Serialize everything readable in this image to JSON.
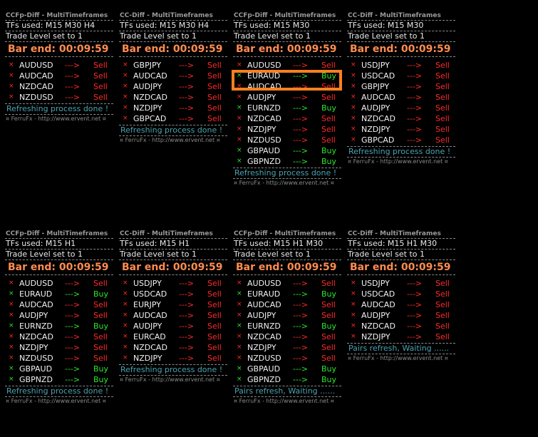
{
  "panels": [
    {
      "title": "CCFp-Diff   -   MultiTimeframes",
      "tfs": "TFs used: M15 M30 H4",
      "trade_level": "Trade Level set to 1",
      "bar_end": "Bar end: 00:09:59",
      "rows": [
        {
          "pair": "AUDUSD",
          "arrow": "--->",
          "signal": "Sell"
        },
        {
          "pair": "AUDCAD",
          "arrow": "--->",
          "signal": "Sell"
        },
        {
          "pair": "NZDCAD",
          "arrow": "--->",
          "signal": "Sell"
        },
        {
          "pair": "NZDUSD",
          "arrow": "--->",
          "signal": "Sell"
        }
      ],
      "status": "Refreshing process done !",
      "footer": "¤ FerruFx  - http://www.ervent.net ¤"
    },
    {
      "title": "CC-Diff   -   MultiTimeframes",
      "tfs": "TFs used: M15 M30 H4",
      "trade_level": "Trade Level set to 1",
      "bar_end": "Bar end: 00:09:59",
      "rows": [
        {
          "pair": "GBPJPY",
          "arrow": "--->",
          "signal": "Sell"
        },
        {
          "pair": "AUDCAD",
          "arrow": "--->",
          "signal": "Sell"
        },
        {
          "pair": "AUDJPY",
          "arrow": "--->",
          "signal": "Sell"
        },
        {
          "pair": "NZDCAD",
          "arrow": "--->",
          "signal": "Sell"
        },
        {
          "pair": "NZDJPY",
          "arrow": "--->",
          "signal": "Sell"
        },
        {
          "pair": "GBPCAD",
          "arrow": "--->",
          "signal": "Sell"
        }
      ],
      "status": "Refreshing process done !",
      "footer": "¤ FerruFx  - http://www.ervent.net ¤"
    },
    {
      "title": "CCFp-Diff   -   MultiTimeframes",
      "tfs": "TFs used: M15 M30",
      "trade_level": "Trade Level set to 1",
      "bar_end": "Bar end: 00:09:59",
      "rows": [
        {
          "pair": "AUDUSD",
          "arrow": "--->",
          "signal": "Sell"
        },
        {
          "pair": "EURAUD",
          "arrow": "--->",
          "signal": "Buy"
        },
        {
          "pair": "AUDCAD",
          "arrow": "--->",
          "signal": "Sell"
        },
        {
          "pair": "AUDJPY",
          "arrow": "--->",
          "signal": "Sell"
        },
        {
          "pair": "EURNZD",
          "arrow": "--->",
          "signal": "Buy"
        },
        {
          "pair": "NZDCAD",
          "arrow": "--->",
          "signal": "Sell"
        },
        {
          "pair": "NZDJPY",
          "arrow": "--->",
          "signal": "Sell"
        },
        {
          "pair": "NZDUSD",
          "arrow": "--->",
          "signal": "Sell"
        },
        {
          "pair": "GBPAUD",
          "arrow": "--->",
          "signal": "Buy"
        },
        {
          "pair": "GBPNZD",
          "arrow": "--->",
          "signal": "Buy"
        }
      ],
      "status": "Refreshing process done !",
      "footer": "¤ FerruFx  - http://www.ervent.net ¤"
    },
    {
      "title": "CC-Diff   -   MultiTimeframes",
      "tfs": "TFs used: M15 M30",
      "trade_level": "Trade Level set to 1",
      "bar_end": "Bar end: 00:09:59",
      "rows": [
        {
          "pair": "USDJPY",
          "arrow": "--->",
          "signal": "Sell"
        },
        {
          "pair": "USDCAD",
          "arrow": "--->",
          "signal": "Sell"
        },
        {
          "pair": "GBPJPY",
          "arrow": "--->",
          "signal": "Sell"
        },
        {
          "pair": "AUDCAD",
          "arrow": "--->",
          "signal": "Sell"
        },
        {
          "pair": "AUDJPY",
          "arrow": "--->",
          "signal": "Sell"
        },
        {
          "pair": "NZDCAD",
          "arrow": "--->",
          "signal": "Sell"
        },
        {
          "pair": "NZDJPY",
          "arrow": "--->",
          "signal": "Sell"
        },
        {
          "pair": "GBPCAD",
          "arrow": "--->",
          "signal": "Sell"
        }
      ],
      "status": "Refreshing process done !",
      "footer": "¤ FerruFx  - http://www.ervent.net ¤"
    },
    {
      "title": "CCFp-Diff   -   MultiTimeframes",
      "tfs": "TFs used: M15 H1",
      "trade_level": "Trade Level set to 1",
      "bar_end": "Bar end: 00:09:59",
      "rows": [
        {
          "pair": "AUDUSD",
          "arrow": "--->",
          "signal": "Sell"
        },
        {
          "pair": "EURAUD",
          "arrow": "--->",
          "signal": "Buy"
        },
        {
          "pair": "AUDCAD",
          "arrow": "--->",
          "signal": "Sell"
        },
        {
          "pair": "AUDJPY",
          "arrow": "--->",
          "signal": "Sell"
        },
        {
          "pair": "EURNZD",
          "arrow": "--->",
          "signal": "Buy"
        },
        {
          "pair": "NZDCAD",
          "arrow": "--->",
          "signal": "Sell"
        },
        {
          "pair": "NZDJPY",
          "arrow": "--->",
          "signal": "Sell"
        },
        {
          "pair": "NZDUSD",
          "arrow": "--->",
          "signal": "Sell"
        },
        {
          "pair": "GBPAUD",
          "arrow": "--->",
          "signal": "Buy"
        },
        {
          "pair": "GBPNZD",
          "arrow": "--->",
          "signal": "Buy"
        }
      ],
      "status": "Refreshing process done !",
      "footer": "¤ FerruFx  - http://www.ervent.net ¤"
    },
    {
      "title": "CC-Diff   -   MultiTimeframes",
      "tfs": "TFs used: M15 H1",
      "trade_level": "Trade Level set to 1",
      "bar_end": "Bar end: 00:09:59",
      "rows": [
        {
          "pair": "USDJPY",
          "arrow": "--->",
          "signal": "Sell"
        },
        {
          "pair": "USDCAD",
          "arrow": "--->",
          "signal": "Sell"
        },
        {
          "pair": "EURJPY",
          "arrow": "--->",
          "signal": "Sell"
        },
        {
          "pair": "AUDCAD",
          "arrow": "--->",
          "signal": "Sell"
        },
        {
          "pair": "AUDJPY",
          "arrow": "--->",
          "signal": "Sell"
        },
        {
          "pair": "EURCAD",
          "arrow": "--->",
          "signal": "Sell"
        },
        {
          "pair": "NZDCAD",
          "arrow": "--->",
          "signal": "Sell"
        },
        {
          "pair": "NZDJPY",
          "arrow": "--->",
          "signal": "Sell"
        }
      ],
      "status": "Refreshing process done !",
      "footer": "¤ FerruFx  - http://www.ervent.net ¤"
    },
    {
      "title": "CCFp-Diff   -   MultiTimeframes",
      "tfs": "TFs used: M15 H1 M30",
      "trade_level": "Trade Level set to 1",
      "bar_end": "Bar end: 00:09:59",
      "rows": [
        {
          "pair": "AUDUSD",
          "arrow": "--->",
          "signal": "Sell"
        },
        {
          "pair": "EURAUD",
          "arrow": "--->",
          "signal": "Buy"
        },
        {
          "pair": "AUDCAD",
          "arrow": "--->",
          "signal": "Sell"
        },
        {
          "pair": "AUDJPY",
          "arrow": "--->",
          "signal": "Sell"
        },
        {
          "pair": "EURNZD",
          "arrow": "--->",
          "signal": "Buy"
        },
        {
          "pair": "NZDCAD",
          "arrow": "--->",
          "signal": "Sell"
        },
        {
          "pair": "NZDJPY",
          "arrow": "--->",
          "signal": "Sell"
        },
        {
          "pair": "NZDUSD",
          "arrow": "--->",
          "signal": "Sell"
        },
        {
          "pair": "GBPAUD",
          "arrow": "--->",
          "signal": "Buy"
        },
        {
          "pair": "GBPNZD",
          "arrow": "--->",
          "signal": "Buy"
        }
      ],
      "status": "Pairs refresh, Waiting ......",
      "footer": "¤ FerruFx  - http://www.ervent.net ¤"
    },
    {
      "title": "CC-Diff   -   MultiTimeframes",
      "tfs": "TFs used: M15 H1 M30",
      "trade_level": "Trade Level set to 1",
      "bar_end": "Bar end: 00:09:59",
      "rows": [
        {
          "pair": "USDJPY",
          "arrow": "--->",
          "signal": "Sell"
        },
        {
          "pair": "USDCAD",
          "arrow": "--->",
          "signal": "Sell"
        },
        {
          "pair": "AUDCAD",
          "arrow": "--->",
          "signal": "Sell"
        },
        {
          "pair": "AUDJPY",
          "arrow": "--->",
          "signal": "Sell"
        },
        {
          "pair": "NZDCAD",
          "arrow": "--->",
          "signal": "Sell"
        },
        {
          "pair": "NZDJPY",
          "arrow": "--->",
          "signal": "Sell"
        }
      ],
      "status": "Pairs refresh, Waiting ......",
      "footer": "¤ FerruFx  - http://www.ervent.net ¤"
    }
  ],
  "icons": {
    "signal_icon": "x-mark-icon",
    "sell_icon_char": "¤",
    "buy_icon_char": "¤"
  },
  "colors": {
    "sell": "#ff2a2a",
    "buy": "#2ae62a",
    "bar_end": "#ff8c50",
    "status": "#4aa3b0",
    "highlight": "#ff7f1e"
  }
}
